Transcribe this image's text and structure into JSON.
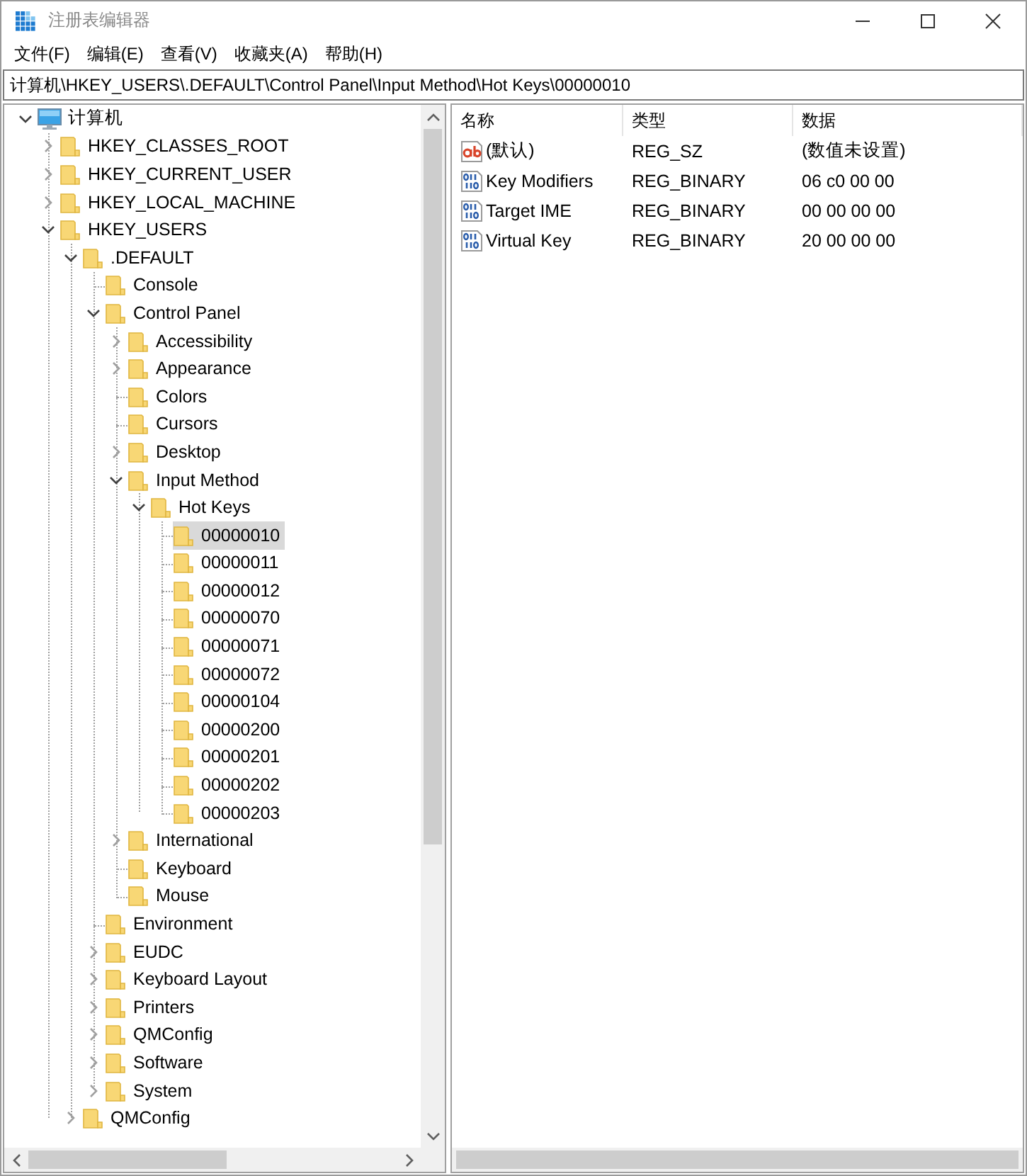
{
  "window": {
    "title": "注册表编辑器"
  },
  "menu": [
    {
      "label": "文件(F)"
    },
    {
      "label": "编辑(E)"
    },
    {
      "label": "查看(V)"
    },
    {
      "label": "收藏夹(A)"
    },
    {
      "label": "帮助(H)"
    }
  ],
  "address": "计算机\\HKEY_USERS\\.DEFAULT\\Control Panel\\Input Method\\Hot Keys\\00000010",
  "tree": {
    "root": {
      "label": "计算机",
      "expandable": true,
      "expanded": true,
      "selected": false,
      "children": [
        {
          "label": "HKEY_CLASSES_ROOT",
          "expandable": true,
          "expanded": false,
          "selected": false
        },
        {
          "label": "HKEY_CURRENT_USER",
          "expandable": true,
          "expanded": false,
          "selected": false
        },
        {
          "label": "HKEY_LOCAL_MACHINE",
          "expandable": true,
          "expanded": false,
          "selected": false
        },
        {
          "label": "HKEY_USERS",
          "expandable": true,
          "expanded": true,
          "selected": false,
          "children": [
            {
              "label": ".DEFAULT",
              "expandable": true,
              "expanded": true,
              "selected": false,
              "children": [
                {
                  "label": "Console",
                  "expandable": false,
                  "expanded": false,
                  "selected": false
                },
                {
                  "label": "Control Panel",
                  "expandable": true,
                  "expanded": true,
                  "selected": false,
                  "children": [
                    {
                      "label": "Accessibility",
                      "expandable": true,
                      "expanded": false,
                      "selected": false
                    },
                    {
                      "label": "Appearance",
                      "expandable": true,
                      "expanded": false,
                      "selected": false
                    },
                    {
                      "label": "Colors",
                      "expandable": false,
                      "expanded": false,
                      "selected": false
                    },
                    {
                      "label": "Cursors",
                      "expandable": false,
                      "expanded": false,
                      "selected": false
                    },
                    {
                      "label": "Desktop",
                      "expandable": true,
                      "expanded": false,
                      "selected": false
                    },
                    {
                      "label": "Input Method",
                      "expandable": true,
                      "expanded": true,
                      "selected": false,
                      "children": [
                        {
                          "label": "Hot Keys",
                          "expandable": true,
                          "expanded": true,
                          "selected": false,
                          "children": [
                            {
                              "label": "00000010",
                              "expandable": false,
                              "expanded": false,
                              "selected": true
                            },
                            {
                              "label": "00000011",
                              "expandable": false,
                              "expanded": false,
                              "selected": false
                            },
                            {
                              "label": "00000012",
                              "expandable": false,
                              "expanded": false,
                              "selected": false
                            },
                            {
                              "label": "00000070",
                              "expandable": false,
                              "expanded": false,
                              "selected": false
                            },
                            {
                              "label": "00000071",
                              "expandable": false,
                              "expanded": false,
                              "selected": false
                            },
                            {
                              "label": "00000072",
                              "expandable": false,
                              "expanded": false,
                              "selected": false
                            },
                            {
                              "label": "00000104",
                              "expandable": false,
                              "expanded": false,
                              "selected": false
                            },
                            {
                              "label": "00000200",
                              "expandable": false,
                              "expanded": false,
                              "selected": false
                            },
                            {
                              "label": "00000201",
                              "expandable": false,
                              "expanded": false,
                              "selected": false
                            },
                            {
                              "label": "00000202",
                              "expandable": false,
                              "expanded": false,
                              "selected": false
                            },
                            {
                              "label": "00000203",
                              "expandable": false,
                              "expanded": false,
                              "selected": false
                            }
                          ]
                        }
                      ]
                    },
                    {
                      "label": "International",
                      "expandable": true,
                      "expanded": false,
                      "selected": false
                    },
                    {
                      "label": "Keyboard",
                      "expandable": false,
                      "expanded": false,
                      "selected": false
                    },
                    {
                      "label": "Mouse",
                      "expandable": false,
                      "expanded": false,
                      "selected": false
                    }
                  ]
                },
                {
                  "label": "Environment",
                  "expandable": false,
                  "expanded": false,
                  "selected": false
                },
                {
                  "label": "EUDC",
                  "expandable": true,
                  "expanded": false,
                  "selected": false
                },
                {
                  "label": "Keyboard Layout",
                  "expandable": true,
                  "expanded": false,
                  "selected": false
                },
                {
                  "label": "Printers",
                  "expandable": true,
                  "expanded": false,
                  "selected": false
                },
                {
                  "label": "QMConfig",
                  "expandable": true,
                  "expanded": false,
                  "selected": false
                },
                {
                  "label": "Software",
                  "expandable": true,
                  "expanded": false,
                  "selected": false
                },
                {
                  "label": "System",
                  "expandable": true,
                  "expanded": false,
                  "selected": false
                }
              ]
            },
            {
              "label": "QMConfig",
              "expandable": true,
              "expanded": false,
              "selected": false
            }
          ]
        }
      ]
    }
  },
  "values": {
    "columns": [
      "名称",
      "类型",
      "数据"
    ],
    "rows": [
      {
        "kind": "string",
        "name": "(默认)",
        "type": "REG_SZ",
        "data": "(数值未设置)"
      },
      {
        "kind": "binary",
        "name": "Key Modifiers",
        "type": "REG_BINARY",
        "data": "06 c0 00 00"
      },
      {
        "kind": "binary",
        "name": "Target IME",
        "type": "REG_BINARY",
        "data": "00 00 00 00"
      },
      {
        "kind": "binary",
        "name": "Virtual Key",
        "type": "REG_BINARY",
        "data": "20 00 00 00"
      }
    ]
  }
}
